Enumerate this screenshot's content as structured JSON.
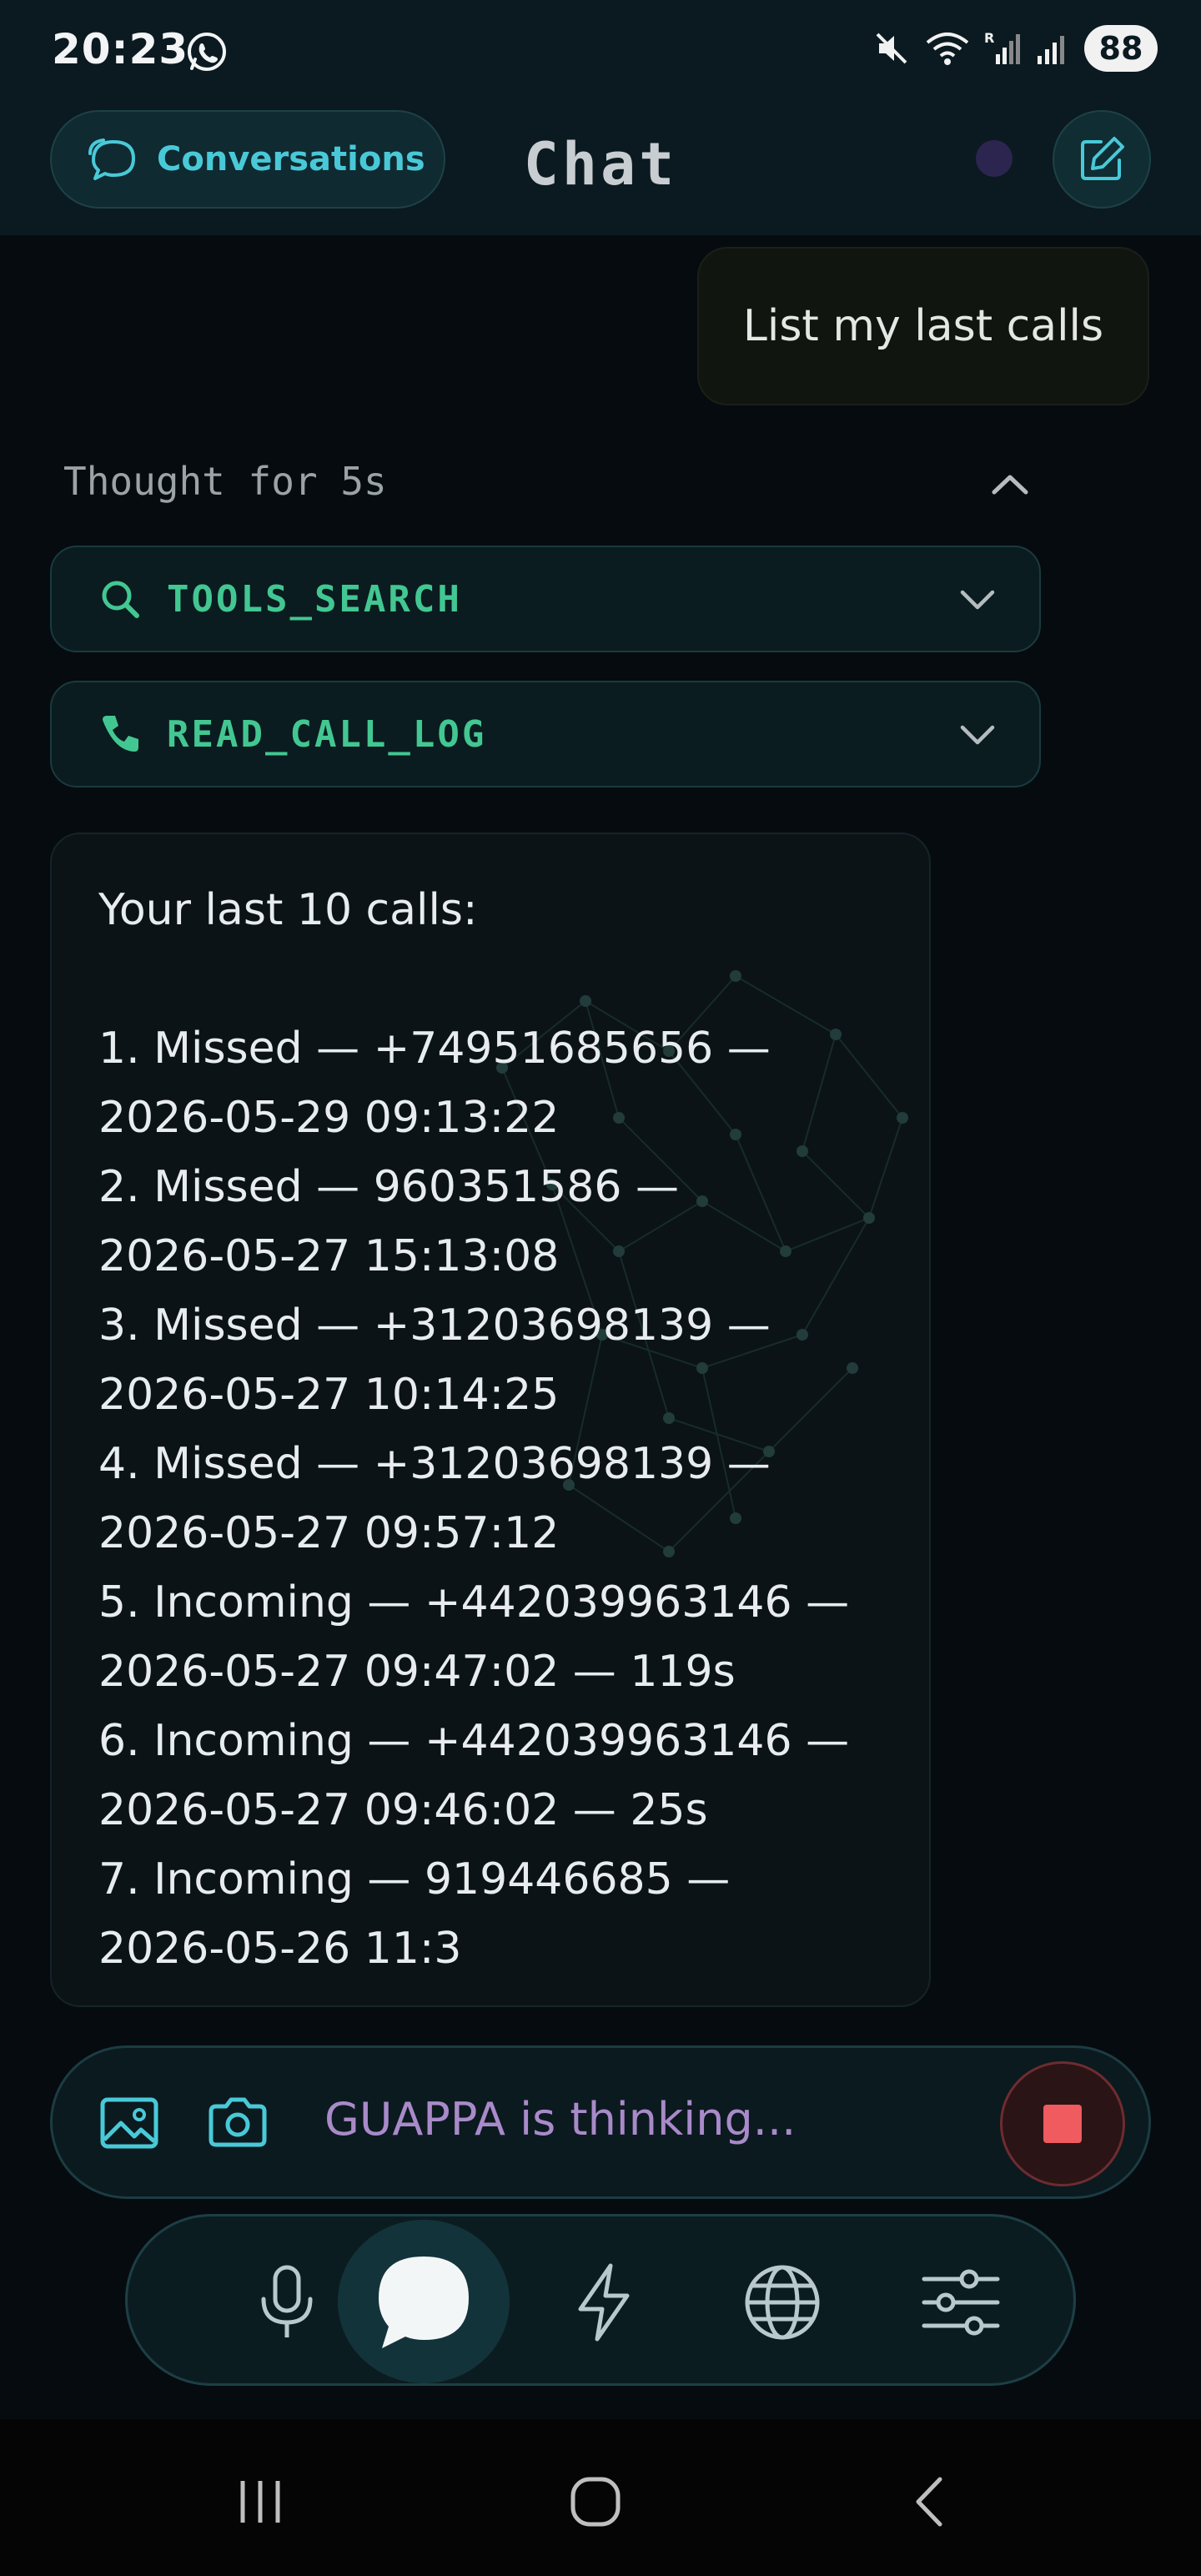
{
  "status_bar": {
    "time": "20:23",
    "battery": "88",
    "icons": [
      "whatsapp-icon",
      "mute-icon",
      "wifi-icon",
      "signal-r-icon",
      "signal-icon"
    ]
  },
  "header": {
    "conversations_label": "Conversations",
    "title": "Chat"
  },
  "messages": {
    "user": "List my last calls",
    "thought": "Thought for 5s",
    "tools": [
      {
        "name": "TOOLS_SEARCH",
        "icon": "search-icon"
      },
      {
        "name": "READ_CALL_LOG",
        "icon": "phone-icon"
      }
    ],
    "assistant_lines": [
      "Your last 10 calls:",
      "",
      "1. Missed — +74951685656 —",
      "2026-05-29 09:13:22",
      "2. Missed — 960351586 —",
      "2026-05-27 15:13:08",
      "3. Missed — +31203698139 —",
      "2026-05-27 10:14:25",
      "4. Missed — +31203698139 —",
      "2026-05-27 09:57:12",
      "5. Incoming — +442039963146 —",
      "2026-05-27 09:47:02 — 119s",
      "6. Incoming — +442039963146 —",
      "2026-05-27 09:46:02 — 25s",
      "7. Incoming — 919446685 —",
      "2026-05-26 11:3"
    ]
  },
  "input": {
    "placeholder": "GUAPPA is thinking..."
  },
  "dock": {
    "items": [
      "microphone-icon",
      "chat-icon",
      "lightning-icon",
      "globe-icon",
      "sliders-icon"
    ],
    "active": "chat-icon"
  },
  "colors": {
    "accent_cyan": "#49c9d8",
    "tool_green": "#43c792",
    "thinking_purple": "#a98ac9",
    "stop_red": "#ef5b5f"
  }
}
